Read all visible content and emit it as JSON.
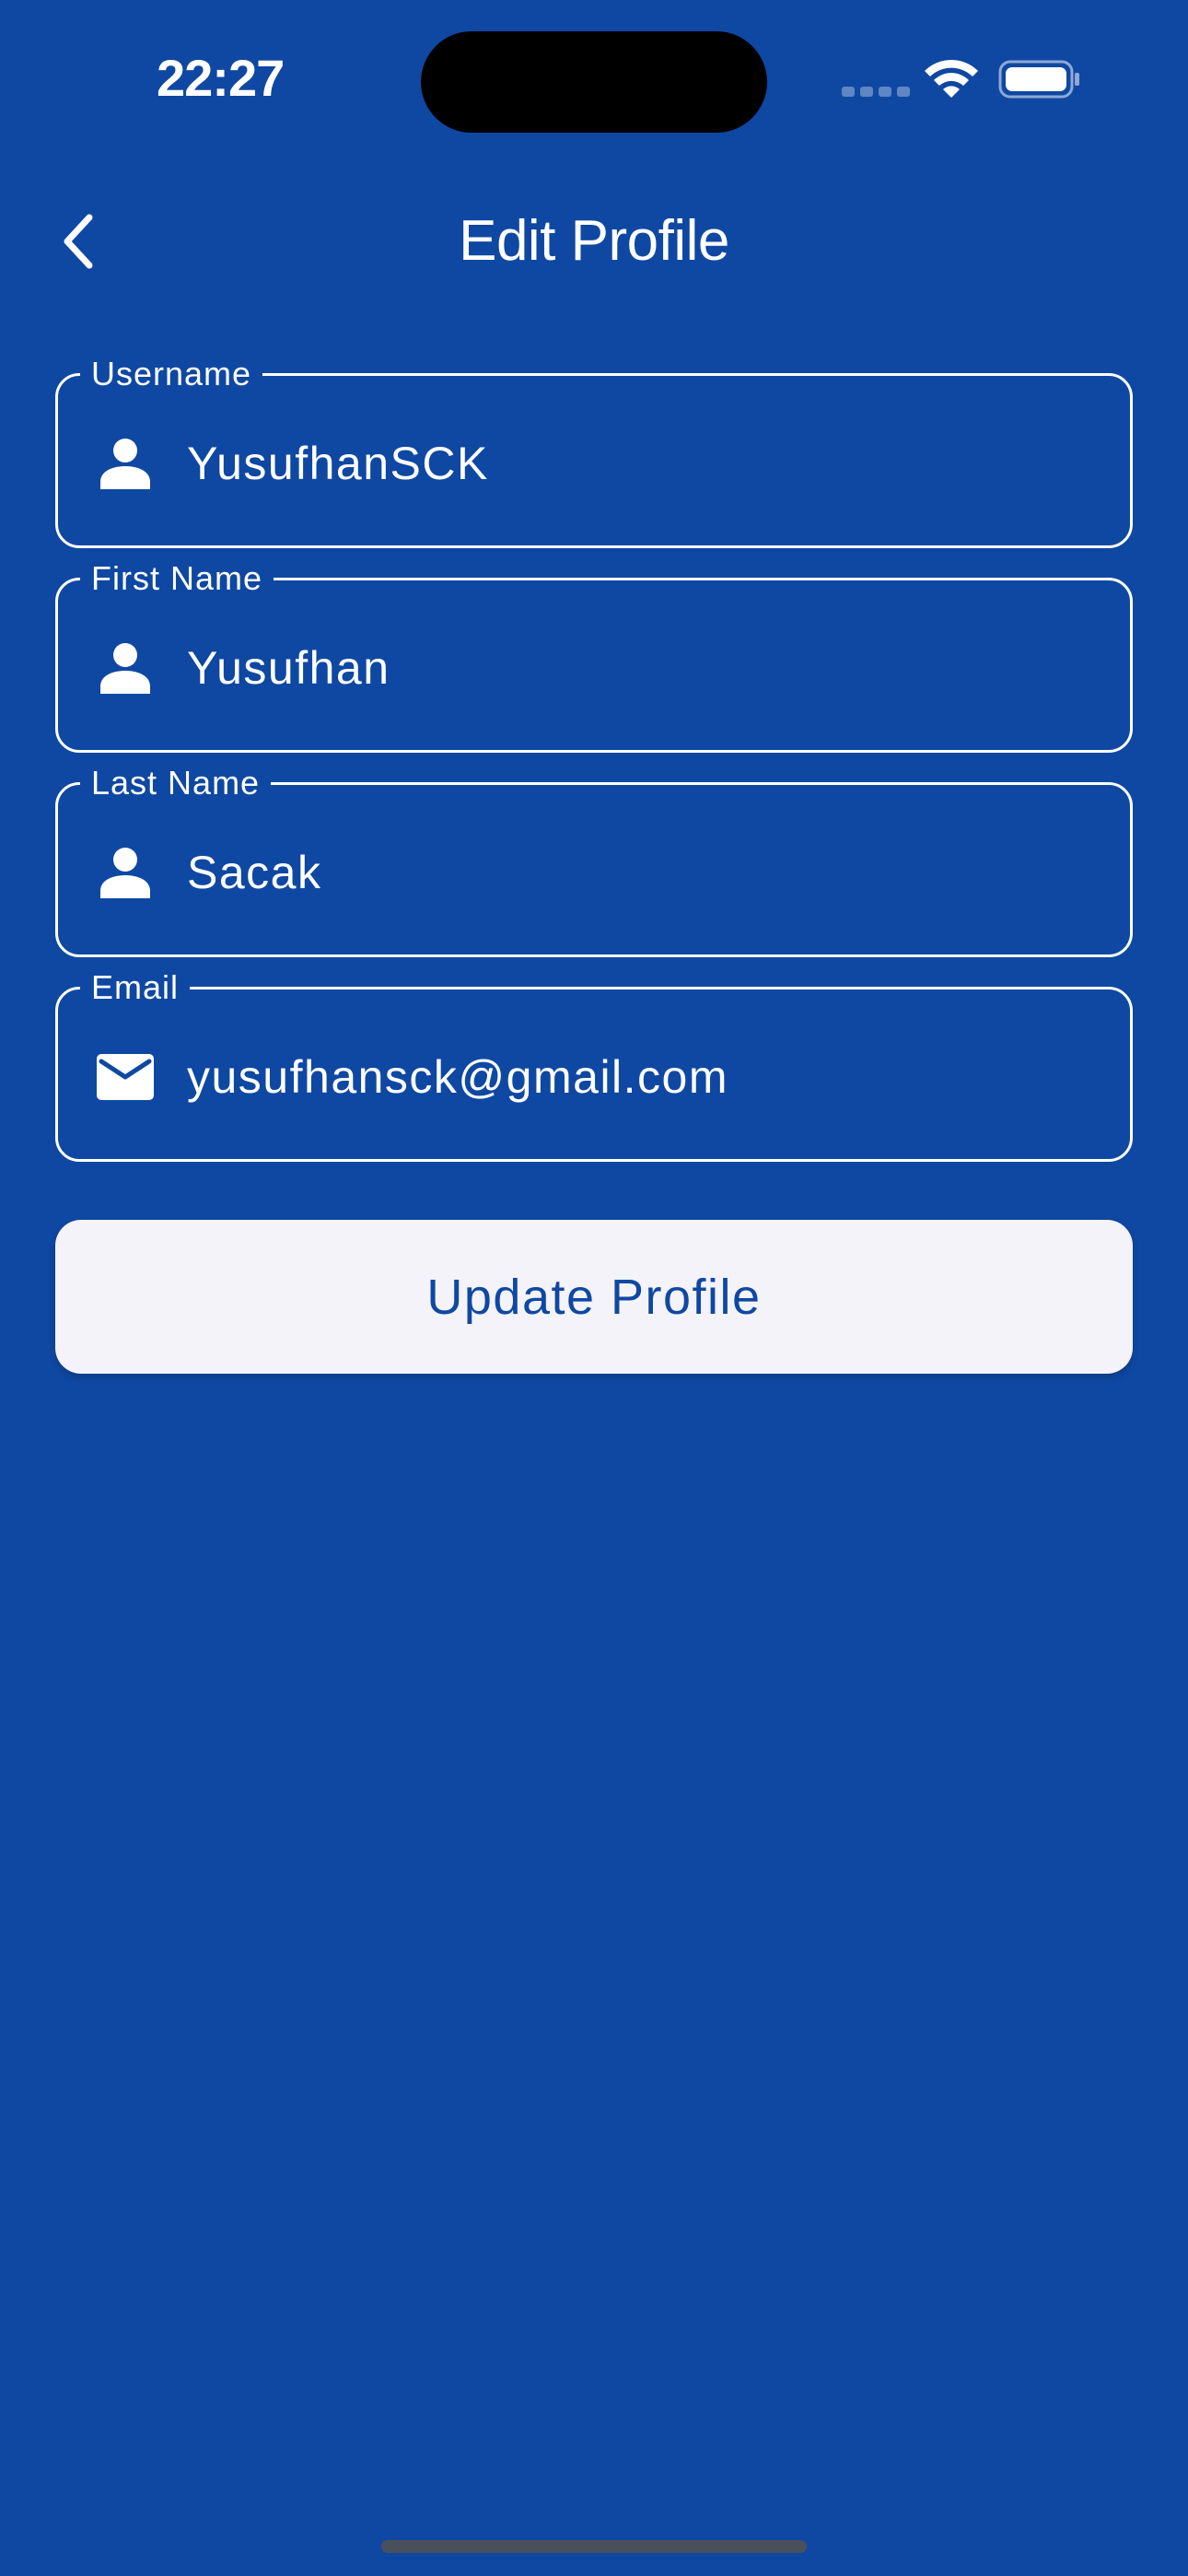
{
  "status_bar": {
    "time": "22:27"
  },
  "header": {
    "title": "Edit Profile",
    "back_icon": "chevron-left-icon"
  },
  "form": {
    "fields": [
      {
        "label": "Username",
        "value": "YusufhanSCK",
        "icon": "person-icon"
      },
      {
        "label": "First Name",
        "value": "Yusufhan",
        "icon": "person-icon"
      },
      {
        "label": "Last Name",
        "value": "Sacak",
        "icon": "person-icon"
      },
      {
        "label": "Email",
        "value": "yusufhansck@gmail.com",
        "icon": "mail-icon"
      }
    ],
    "submit_label": "Update Profile"
  },
  "colors": {
    "background": "#0f48a2",
    "button_bg": "#f4f3f9",
    "button_text": "#0f48a2",
    "text": "#ffffff"
  }
}
